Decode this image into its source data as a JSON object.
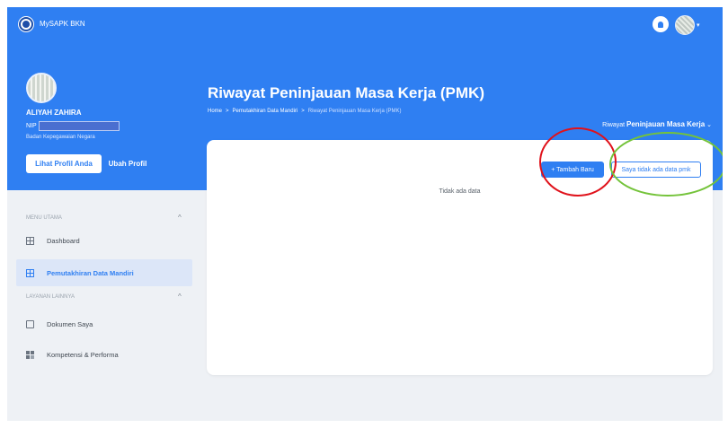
{
  "app": {
    "name": "MySAPK BKN"
  },
  "profile": {
    "name": "ALIYAH ZAHIRA",
    "nip_label": "NIP",
    "agency": "Badan Kepegawaian Negara",
    "view_profile_label": "Lihat Profil Anda",
    "edit_profile_label": "Ubah Profil"
  },
  "page": {
    "title": "Riwayat Peninjauan Masa Kerja (PMK)",
    "breadcrumb": [
      "Home",
      ">",
      "Pemutakhiran Data Mandiri",
      ">",
      "Riwayat Peninjauan Masa Kerja (PMK)"
    ],
    "type_select_prefix": "Riwayat",
    "type_select_value": "Peninjauan Masa Kerja",
    "type_select_caret": "⌄"
  },
  "sidebar": {
    "sections": [
      {
        "title": "MENU UTAMA",
        "caret": "^"
      },
      {
        "title": "LAYANAN LAINNYA",
        "caret": "^"
      }
    ],
    "items": [
      {
        "label": "Dashboard",
        "icon": "grid-icon",
        "active": false
      },
      {
        "label": "Pemutakhiran Data Mandiri",
        "icon": "grid-icon",
        "active": true
      },
      {
        "label": "Dokumen Saya",
        "icon": "document-icon",
        "active": false
      },
      {
        "label": "Kompetensi & Performa",
        "icon": "blocks-icon",
        "active": false
      }
    ]
  },
  "card": {
    "add_button_label": "+ Tambah Baru",
    "no_data_button_label": "Saya tidak ada data pmk",
    "empty_text": "Tidak ada data"
  },
  "colors": {
    "primary": "#2f7ff2",
    "annotation_red": "#e0121b",
    "annotation_green": "#74c33a"
  }
}
